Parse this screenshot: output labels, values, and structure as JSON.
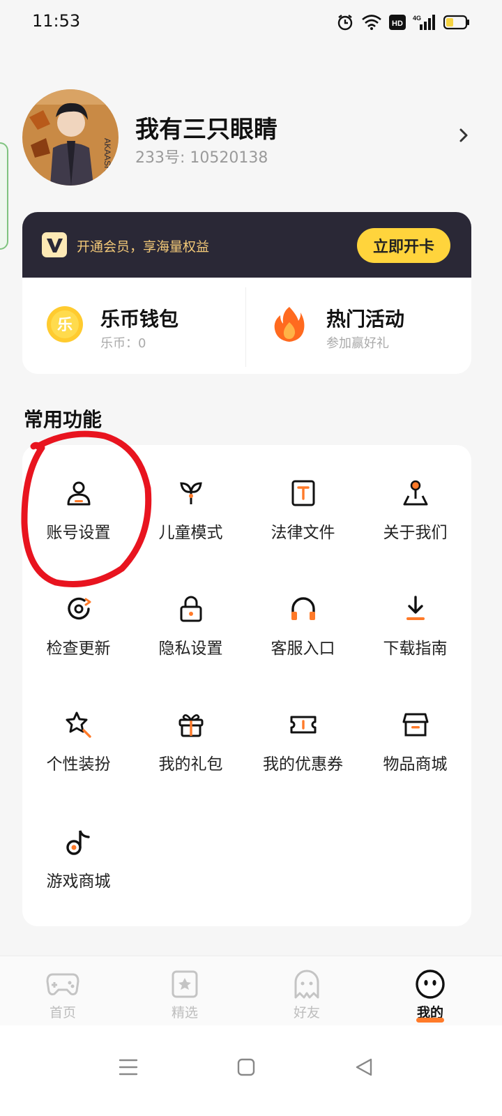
{
  "status_bar": {
    "time": "11:53",
    "hd_badge": "HD",
    "network_label": "4G",
    "icons": [
      "alarm-icon",
      "wifi-icon",
      "hd-icon",
      "signal-icon",
      "battery-icon"
    ]
  },
  "profile": {
    "nickname": "我有三只眼睛",
    "user_id": "233号: 10520138",
    "avatar_text": "AKAASHI"
  },
  "vip": {
    "logo": "V",
    "text": "开通会员，享海量权益",
    "button_label": "立即开卡"
  },
  "wallet": {
    "coin_glyph": "乐",
    "title": "乐币钱包",
    "subtitle": "乐币：0"
  },
  "activity": {
    "title": "热门活动",
    "subtitle": "参加赢好礼"
  },
  "section_title": "常用功能",
  "functions": [
    {
      "label": "账号设置",
      "icon": "person-icon"
    },
    {
      "label": "儿童模式",
      "icon": "sprout-icon"
    },
    {
      "label": "法律文件",
      "icon": "document-icon"
    },
    {
      "label": "关于我们",
      "icon": "map-pin-icon"
    },
    {
      "label": "检查更新",
      "icon": "refresh-icon"
    },
    {
      "label": "隐私设置",
      "icon": "lock-icon"
    },
    {
      "label": "客服入口",
      "icon": "headset-icon"
    },
    {
      "label": "下载指南",
      "icon": "download-icon"
    },
    {
      "label": "个性装扮",
      "icon": "star-wand-icon"
    },
    {
      "label": "我的礼包",
      "icon": "gift-icon"
    },
    {
      "label": "我的优惠券",
      "icon": "ticket-icon"
    },
    {
      "label": "物品商城",
      "icon": "store-icon"
    },
    {
      "label": "游戏商城",
      "icon": "music-note-icon"
    }
  ],
  "tabs": [
    {
      "label": "首页",
      "icon": "gamepad-icon",
      "active": false
    },
    {
      "label": "精选",
      "icon": "star-badge-icon",
      "active": false
    },
    {
      "label": "好友",
      "icon": "ghost-icon",
      "active": false
    },
    {
      "label": "我的",
      "icon": "face-icon",
      "active": true
    }
  ],
  "colors": {
    "accent": "#ff7a29",
    "vip_button": "#ffd43c",
    "vip_banner": "#2a2836",
    "vip_text": "#f3c978",
    "annotation": "#e8141f"
  }
}
